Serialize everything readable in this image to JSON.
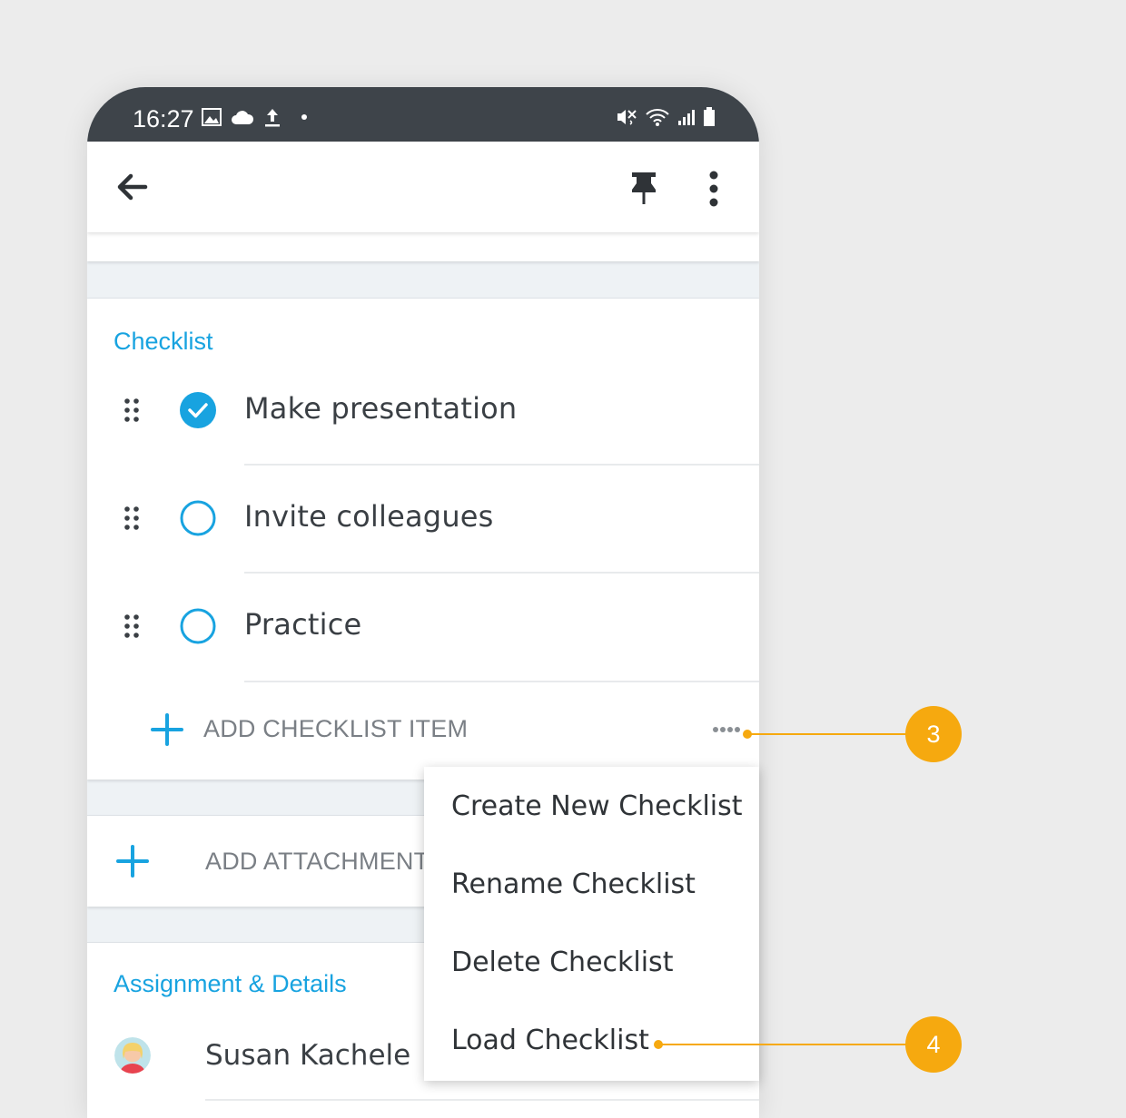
{
  "status_bar": {
    "time": "16:27",
    "left_icons": [
      "image-icon",
      "cloud-icon",
      "upload-icon",
      "dot-icon"
    ],
    "right_icons": [
      "mute-icon",
      "wifi-icon",
      "signal-icon",
      "battery-icon"
    ]
  },
  "app_bar": {
    "back_icon": "arrow-left-icon",
    "actions": [
      "pin-icon",
      "more-vertical-icon"
    ]
  },
  "checklist": {
    "title": "Checklist",
    "items": [
      {
        "label": "Make presentation",
        "checked": true
      },
      {
        "label": "Invite colleagues",
        "checked": false
      },
      {
        "label": "Practice",
        "checked": false
      }
    ],
    "add_label": "ADD CHECKLIST ITEM"
  },
  "attachment": {
    "add_label": "ADD ATTACHMENT"
  },
  "assignment": {
    "title": "Assignment & Details",
    "assignee": "Susan Kachele"
  },
  "menu": {
    "items": [
      "Create New Checklist",
      "Rename Checklist",
      "Delete Checklist",
      "Load Checklist"
    ]
  },
  "callouts": [
    "3",
    "4"
  ],
  "colors": {
    "accent": "#18a3e0",
    "callout": "#f6a90f",
    "status_bar": "#3e444a"
  }
}
